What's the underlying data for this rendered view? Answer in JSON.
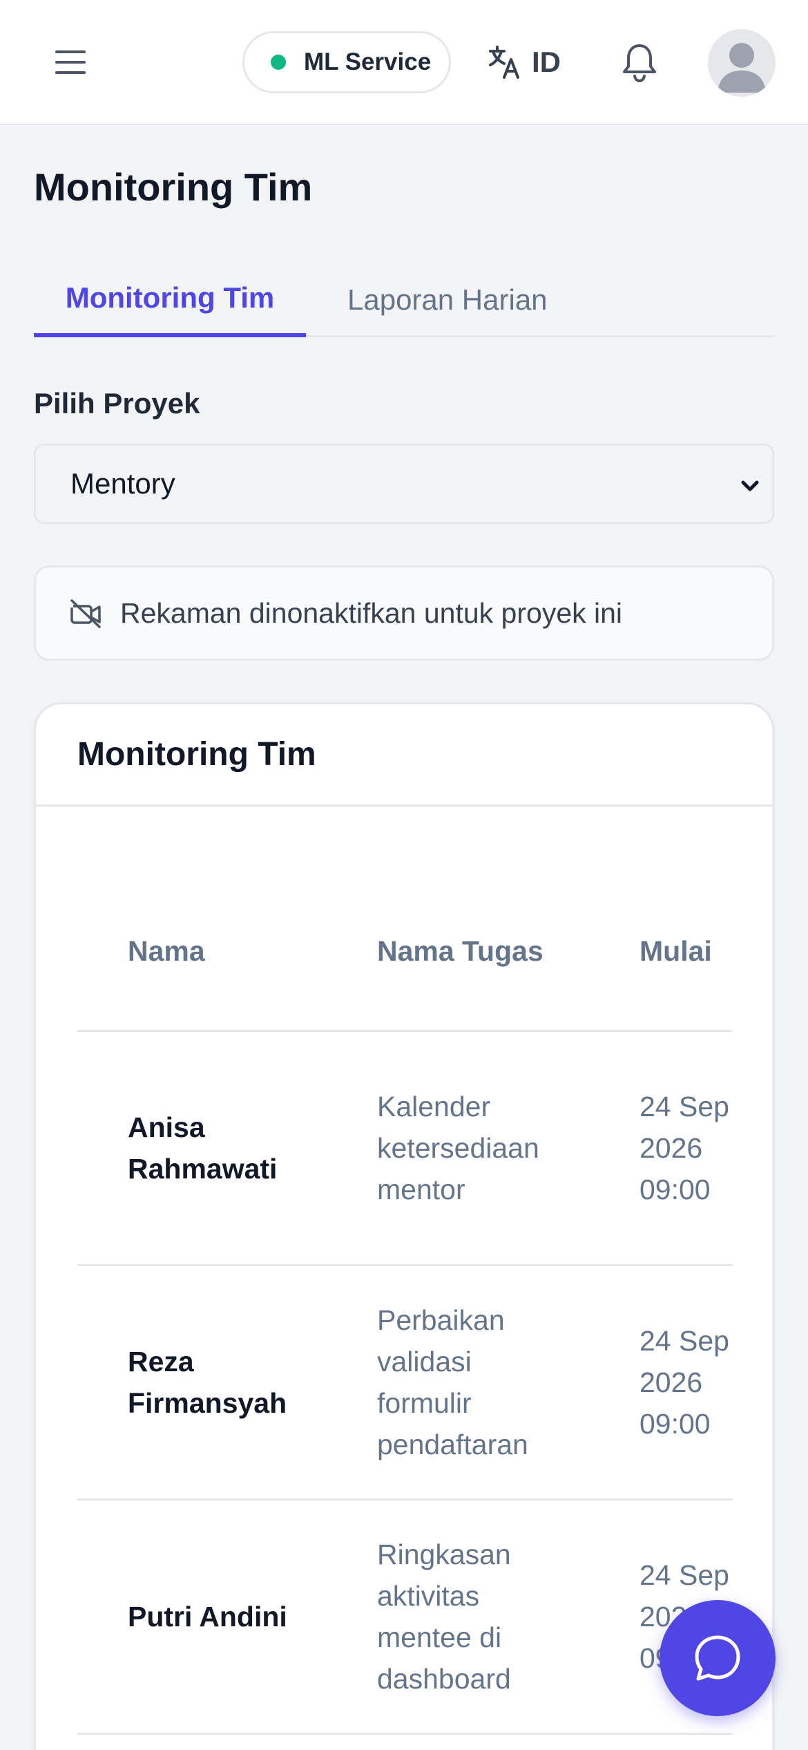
{
  "header": {
    "service_status": "ML Service",
    "language": "ID",
    "icons": [
      "menu-icon",
      "translate-icon",
      "bell-icon",
      "avatar"
    ]
  },
  "page": {
    "title": "Monitoring Tim"
  },
  "tabs": [
    {
      "label": "Monitoring Tim",
      "active": true
    },
    {
      "label": "Laporan Harian",
      "active": false
    }
  ],
  "project_select": {
    "label": "Pilih Proyek",
    "value": "Mentory"
  },
  "notice": {
    "text": "Rekaman dinonaktifkan untuk proyek ini",
    "icon": "video-off-icon"
  },
  "card": {
    "title": "Monitoring Tim",
    "columns": [
      "Nama",
      "Nama Tugas",
      "Mulai"
    ],
    "rows": [
      {
        "name": "Anisa Rahmawati",
        "task": "Kalender ketersediaan mentor",
        "start": "24 Sep 2026 09:00"
      },
      {
        "name": "Reza Firmansyah",
        "task": "Perbaikan validasi formulir pendaftaran",
        "start": "24 Sep 2026 09:00"
      },
      {
        "name": "Putri Andini",
        "task": "Ringkasan aktivitas mentee di dashboard",
        "start": "24 Sep 2026 09:00"
      }
    ]
  },
  "colors": {
    "accent": "#4f46e5",
    "status_online": "#10b981"
  }
}
